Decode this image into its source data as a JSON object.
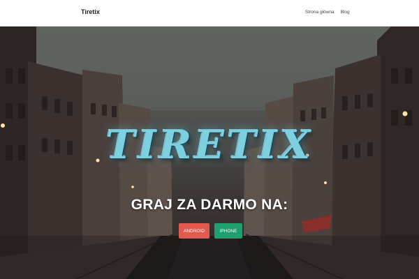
{
  "navbar": {
    "brand": "Tiretix",
    "links": [
      "Strona główna",
      "Blog"
    ]
  },
  "hero": {
    "logo_text": "TIRETIX",
    "headline": "GRAJ ZA DARMO NA:",
    "buttons": {
      "android": "ANDROID",
      "iphone": "IPHONE"
    }
  },
  "colors": {
    "android_button": "#e25a4d",
    "iphone_button": "#1f9e6e",
    "logo": "#7cd0df"
  }
}
